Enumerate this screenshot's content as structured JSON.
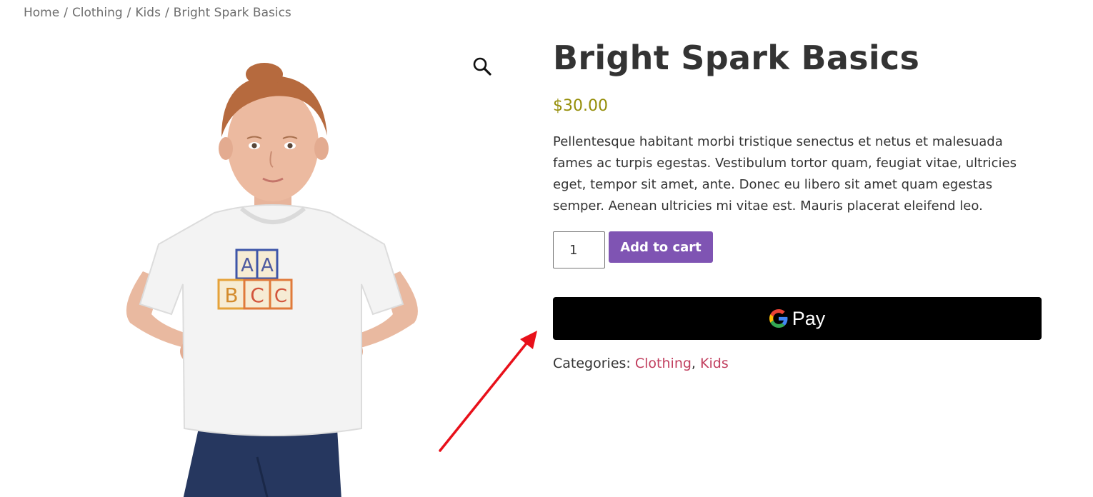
{
  "breadcrumb": {
    "items": [
      "Home",
      "Clothing",
      "Kids",
      "Bright Spark Basics"
    ],
    "separator": "/"
  },
  "gallery": {
    "zoom_icon": "magnifier-icon",
    "image_alt": "Girl wearing white t-shirt with ABC blocks print"
  },
  "product": {
    "title": "Bright Spark Basics",
    "price": "$30.00",
    "description": "Pellentesque habitant morbi tristique senectus et netus et malesuada fames ac turpis egestas. Vestibulum tortor quam, feugiat vitae, ultricies eget, tempor sit amet, ante. Donec eu libero sit amet quam egestas semper. Aenean ultricies mi vitae est. Mauris placerat eleifend leo.",
    "quantity": "1",
    "add_to_cart_label": "Add to cart",
    "gpay_label": "Pay",
    "categories_label": "Categories:",
    "categories": [
      "Clothing",
      "Kids"
    ],
    "category_separator": ","
  },
  "colors": {
    "price": "#958e09",
    "add_to_cart": "#7f54b3",
    "category_link": "#c13e5e",
    "annotation_arrow": "#e8101a"
  }
}
